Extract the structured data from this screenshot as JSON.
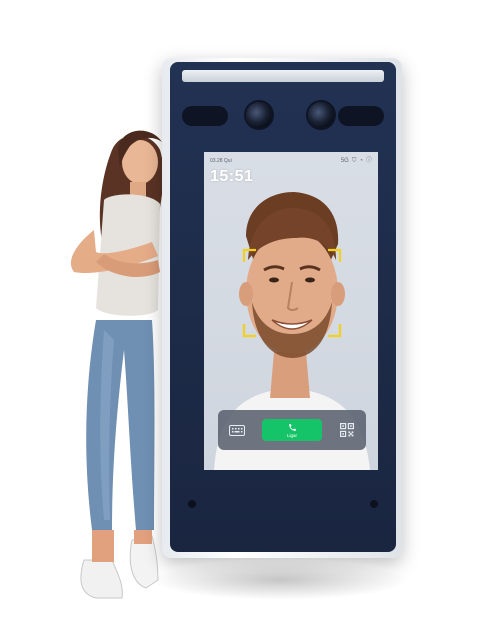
{
  "device": {
    "status_bar": {
      "date": "03.28 Qui",
      "indicators": [
        "5G-icon",
        "shield-icon",
        "wifi-icon",
        "info-icon"
      ]
    },
    "clock": "15:51",
    "bottom_bar": {
      "keyboard_icon": "keyboard-icon",
      "call_label": "Ligar",
      "call_icon": "phone-icon",
      "qr_icon": "qr-code-icon"
    },
    "face_frame_color": "#f3d11a",
    "call_button_color": "#15c468"
  }
}
